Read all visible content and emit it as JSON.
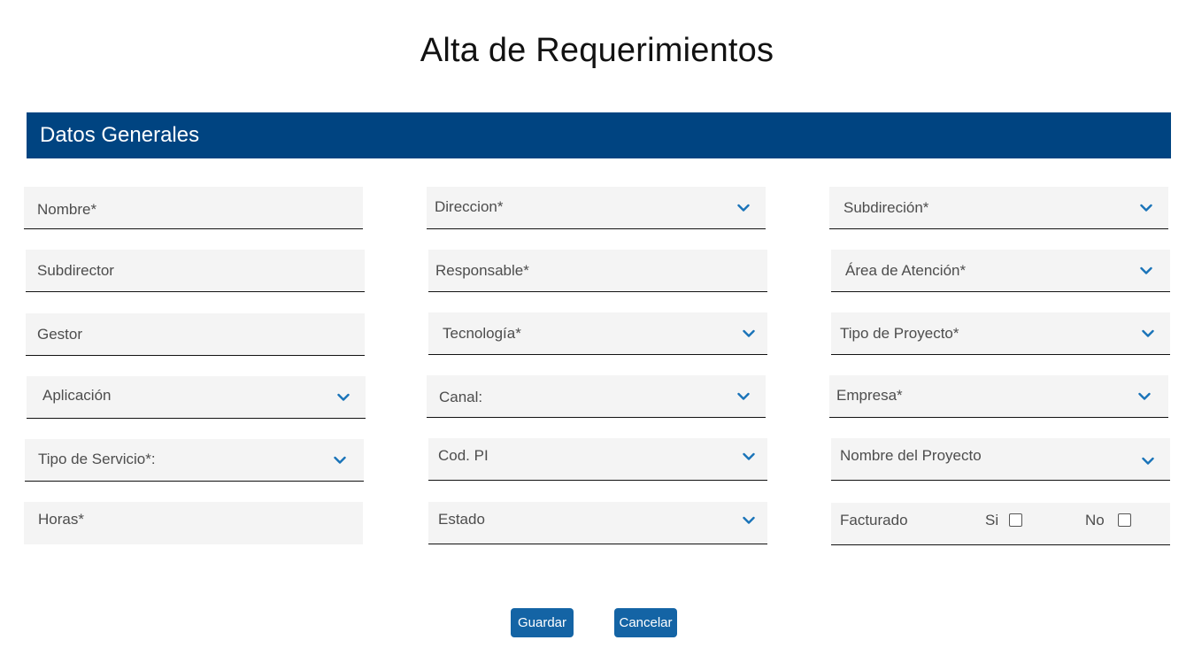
{
  "page": {
    "title": "Alta de Requerimientos"
  },
  "section": {
    "title": "Datos Generales"
  },
  "fields": {
    "nombre": "Nombre*",
    "direccion": "Direccion*",
    "subdireccion": "Subdireción*",
    "subdirector": "Subdirector",
    "responsable": "Responsable*",
    "area_atencion": "Área de Atención*",
    "gestor": "Gestor",
    "tecnologia": "Tecnología*",
    "tipo_proyecto": "Tipo de Proyecto*",
    "aplicacion": "Aplicación",
    "canal": "Canal:",
    "empresa": "Empresa*",
    "tipo_servicio": "Tipo de Servicio*:",
    "cod_pi": "Cod. PI",
    "nombre_proyecto": "Nombre del Proyecto",
    "horas": "Horas*",
    "estado": "Estado",
    "facturado": {
      "label": "Facturado",
      "option_si": "Si",
      "option_no": "No"
    }
  },
  "actions": {
    "save_label": "Guardar",
    "cancel_label": "Cancelar"
  },
  "colors": {
    "header_bg": "#004481",
    "button_bg": "#1464a5",
    "chevron": "#1973b8",
    "field_bg": "#f4f4f4"
  },
  "icons": {
    "dropdown": "chevron-down-icon"
  }
}
